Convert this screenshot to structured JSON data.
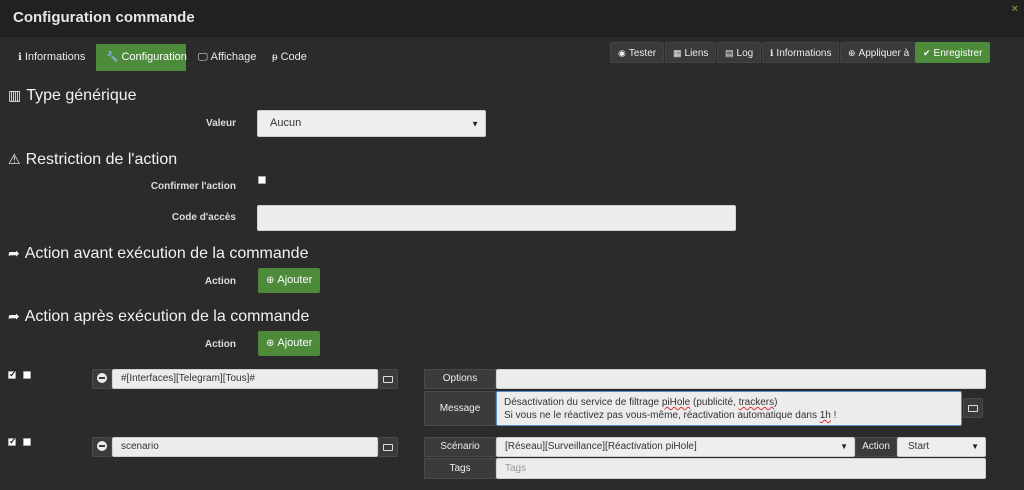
{
  "window": {
    "title": "Configuration commande",
    "close_icon": "×"
  },
  "tabs": [
    {
      "label": "Informations",
      "icon": "info-circle-icon"
    },
    {
      "label": "Configuration",
      "icon": "wrench-icon"
    },
    {
      "label": "Affichage",
      "icon": "desktop-icon"
    },
    {
      "label": "Code",
      "icon": "code-icon"
    }
  ],
  "toolbar": {
    "tester": "Tester",
    "liens": "Liens",
    "log": "Log",
    "informations": "Informations",
    "appliquer": "Appliquer à",
    "enregistrer": "Enregistrer"
  },
  "colors": {
    "accent": "#4d8a3a",
    "background": "#2b2b2b",
    "titlebar": "#212121"
  },
  "type_generique": {
    "title": "Type générique",
    "valeur_label": "Valeur",
    "valeur_value": "Aucun"
  },
  "restriction": {
    "title": "Restriction de l'action",
    "confirmer_label": "Confirmer l'action",
    "confirmer_checked": false,
    "code_label": "Code d'accès",
    "code_value": ""
  },
  "action_avant": {
    "title": "Action avant exécution de la commande",
    "action_label": "Action",
    "ajouter": "Ajouter"
  },
  "action_apres": {
    "title": "Action après exécution de la commande",
    "action_label": "Action",
    "ajouter": "Ajouter",
    "rows": [
      {
        "enabled": true,
        "parallel": false,
        "command": "#[Interfaces][Telegram][Tous]#",
        "options_label": "Options",
        "options_value": "",
        "message_label": "Message",
        "message_line1_a": "Désactivation du service de filtrage ",
        "message_line1_b": "piHole",
        "message_line1_c": " (publicité, ",
        "message_line1_d": "trackers",
        "message_line1_e": ")",
        "message_line2_a": "Si vous ne le réactivez pas vous-même, réactivation automatique dans ",
        "message_line2_b": "1h",
        "message_line2_c": " !"
      },
      {
        "enabled": true,
        "parallel": false,
        "command": "scenario",
        "scenario_label": "Scénario",
        "scenario_value": "[Réseau][Surveillance][Réactivation piHole]",
        "action_label": "Action",
        "action_value": "Start",
        "tags_label": "Tags",
        "tags_placeholder": "Tags"
      }
    ]
  }
}
